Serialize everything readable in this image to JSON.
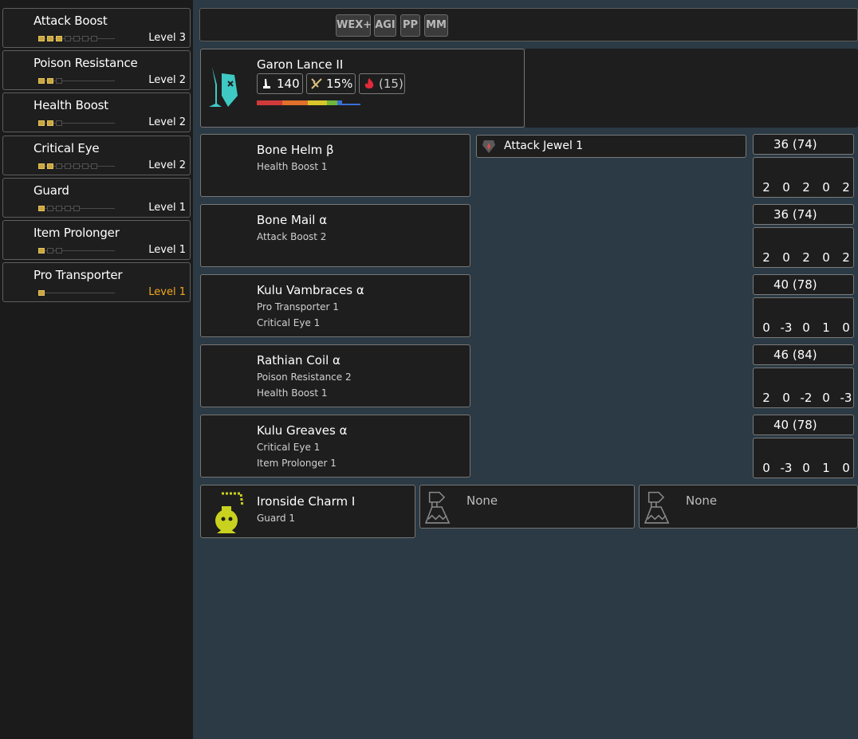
{
  "skills": [
    {
      "name": "Attack Boost",
      "level": "Level 3",
      "max": 7,
      "filled": 3,
      "color": "#e53a55"
    },
    {
      "name": "Poison Resistance",
      "level": "Level 2",
      "max": 3,
      "filled": 2,
      "color": "#8a6be8"
    },
    {
      "name": "Health Boost",
      "level": "Level 2",
      "max": 3,
      "filled": 2,
      "color": "#3bbf6b"
    },
    {
      "name": "Critical Eye",
      "level": "Level 2",
      "max": 7,
      "filled": 2,
      "color": "#4a45e0"
    },
    {
      "name": "Guard",
      "level": "Level 1",
      "max": 5,
      "filled": 1,
      "color": "#b9b9b9"
    },
    {
      "name": "Item Prolonger",
      "level": "Level 1",
      "max": 3,
      "filled": 1,
      "color": "#c9a36a"
    },
    {
      "name": "Pro Transporter",
      "level": "Level 1",
      "max": 1,
      "filled": 1,
      "color": "#c9a36a",
      "is_max": true
    }
  ],
  "topbar": {
    "tags": [
      "WEX+",
      "AGI",
      "PP",
      "MM"
    ],
    "icons": [
      "pink-potion-icon",
      "pink-claw-icon",
      "tan-potion-icon",
      "tan-claw-icon",
      "green-arrow-icon"
    ]
  },
  "weapon": {
    "name": "Garon Lance II",
    "attack": "140",
    "affinity": "15%",
    "element": "(15)",
    "sharpness_fractions": [
      0.28,
      0.28,
      0.21,
      0.12,
      0.05,
      0.2
    ],
    "sharpness_colors": [
      "#d03a3a",
      "#e0702a",
      "#d8c72a",
      "#6fb83a",
      "#3a6fd8",
      "#3a6fd8"
    ]
  },
  "armor": [
    {
      "name": "Bone Helm β",
      "skills": [
        "Health Boost 1"
      ],
      "defense": "36  (74)",
      "res": [
        "2",
        "0",
        "2",
        "0",
        "2"
      ]
    },
    {
      "name": "Bone Mail α",
      "skills": [
        "Attack Boost 2"
      ],
      "defense": "36  (74)",
      "res": [
        "2",
        "0",
        "2",
        "0",
        "2"
      ]
    },
    {
      "name": "Kulu Vambraces α",
      "skills": [
        "Pro Transporter 1",
        "Critical Eye 1"
      ],
      "defense": "40  (78)",
      "res": [
        "0",
        "-3",
        "0",
        "1",
        "0"
      ]
    },
    {
      "name": "Rathian Coil α",
      "skills": [
        "Poison Resistance 2",
        "Health Boost 1"
      ],
      "defense": "46  (84)",
      "res": [
        "2",
        "0",
        "-2",
        "0",
        "-3"
      ]
    },
    {
      "name": "Kulu Greaves α",
      "skills": [
        "Critical Eye 1",
        "Item Prolonger 1"
      ],
      "defense": "40  (78)",
      "res": [
        "0",
        "-3",
        "0",
        "1",
        "0"
      ]
    }
  ],
  "jewel": {
    "name": "Attack Jewel 1"
  },
  "charm": {
    "name": "Ironside Charm I",
    "skills": [
      "Guard 1"
    ]
  },
  "empty_slots": [
    "None",
    "None"
  ]
}
